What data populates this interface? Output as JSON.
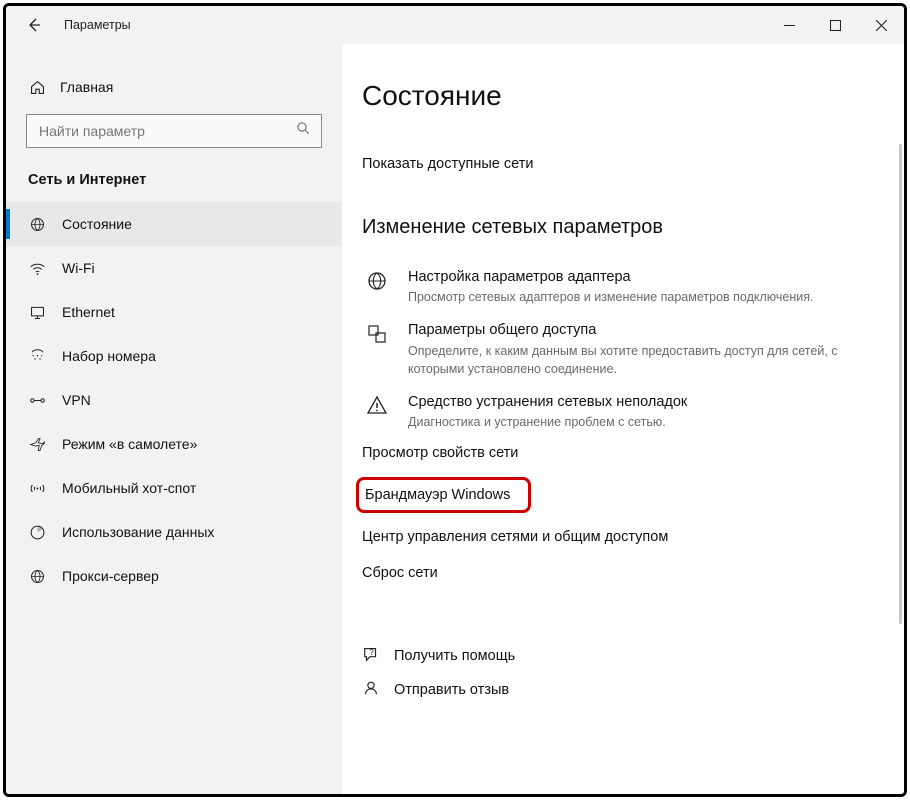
{
  "titlebar": {
    "title": "Параметры"
  },
  "sidebar": {
    "home_label": "Главная",
    "search_placeholder": "Найти параметр",
    "section_title": "Сеть и Интернет",
    "items": [
      {
        "label": "Состояние",
        "icon": "status",
        "selected": true
      },
      {
        "label": "Wi-Fi",
        "icon": "wifi",
        "selected": false
      },
      {
        "label": "Ethernet",
        "icon": "ethernet",
        "selected": false
      },
      {
        "label": "Набор номера",
        "icon": "dialup",
        "selected": false
      },
      {
        "label": "VPN",
        "icon": "vpn",
        "selected": false
      },
      {
        "label": "Режим «в самолете»",
        "icon": "airplane",
        "selected": false
      },
      {
        "label": "Мобильный хот-спот",
        "icon": "hotspot",
        "selected": false
      },
      {
        "label": "Использование данных",
        "icon": "datausage",
        "selected": false
      },
      {
        "label": "Прокси-сервер",
        "icon": "proxy",
        "selected": false
      }
    ]
  },
  "main": {
    "heading": "Состояние",
    "show_networks_link": "Показать доступные сети",
    "subheader": "Изменение сетевых параметров",
    "options": [
      {
        "title": "Настройка параметров адаптера",
        "desc": "Просмотр сетевых адаптеров и изменение параметров подключения.",
        "icon": "globe"
      },
      {
        "title": "Параметры общего доступа",
        "desc": "Определите, к каким данным вы хотите предоставить доступ для сетей, с которыми установлено соединение.",
        "icon": "sharing"
      },
      {
        "title": "Средство устранения сетевых неполадок",
        "desc": "Диагностика и устранение проблем с сетью.",
        "icon": "troubleshoot"
      }
    ],
    "links": {
      "view_properties": "Просмотр свойств сети",
      "firewall": "Брандмауэр Windows",
      "network_center": "Центр управления сетями и общим доступом",
      "reset": "Сброс сети"
    },
    "footer": {
      "get_help": "Получить помощь",
      "feedback": "Отправить отзыв"
    }
  }
}
